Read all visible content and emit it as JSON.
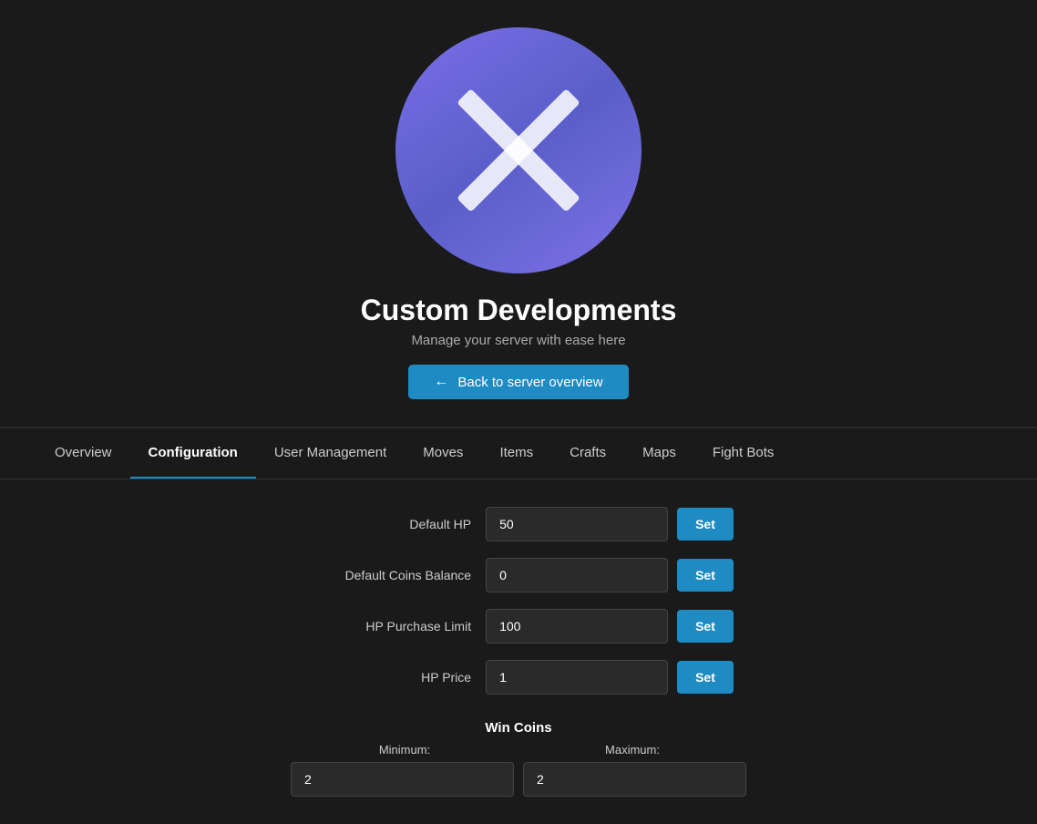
{
  "app": {
    "title": "Custom Developments",
    "subtitle": "Manage your server with ease here",
    "back_button_label": "Back to server overview"
  },
  "nav": {
    "tabs": [
      {
        "id": "overview",
        "label": "Overview",
        "active": false
      },
      {
        "id": "configuration",
        "label": "Configuration",
        "active": true
      },
      {
        "id": "user-management",
        "label": "User Management",
        "active": false
      },
      {
        "id": "moves",
        "label": "Moves",
        "active": false
      },
      {
        "id": "items",
        "label": "Items",
        "active": false
      },
      {
        "id": "crafts",
        "label": "Crafts",
        "active": false
      },
      {
        "id": "maps",
        "label": "Maps",
        "active": false
      },
      {
        "id": "fight-bots",
        "label": "Fight Bots",
        "active": false
      }
    ]
  },
  "configuration": {
    "fields": [
      {
        "id": "default-hp",
        "label": "Default HP",
        "value": "50",
        "button_label": "Set"
      },
      {
        "id": "default-coins-balance",
        "label": "Default Coins Balance",
        "value": "0",
        "button_label": "Set"
      },
      {
        "id": "hp-purchase-limit",
        "label": "HP Purchase Limit",
        "value": "100",
        "button_label": "Set"
      },
      {
        "id": "hp-price",
        "label": "HP Price",
        "value": "1",
        "button_label": "Set"
      }
    ],
    "win_coins": {
      "title": "Win Coins",
      "minimum_label": "Minimum:",
      "maximum_label": "Maximum:",
      "minimum_value": "2",
      "maximum_value": "2"
    }
  },
  "icons": {
    "back_arrow": "←"
  }
}
